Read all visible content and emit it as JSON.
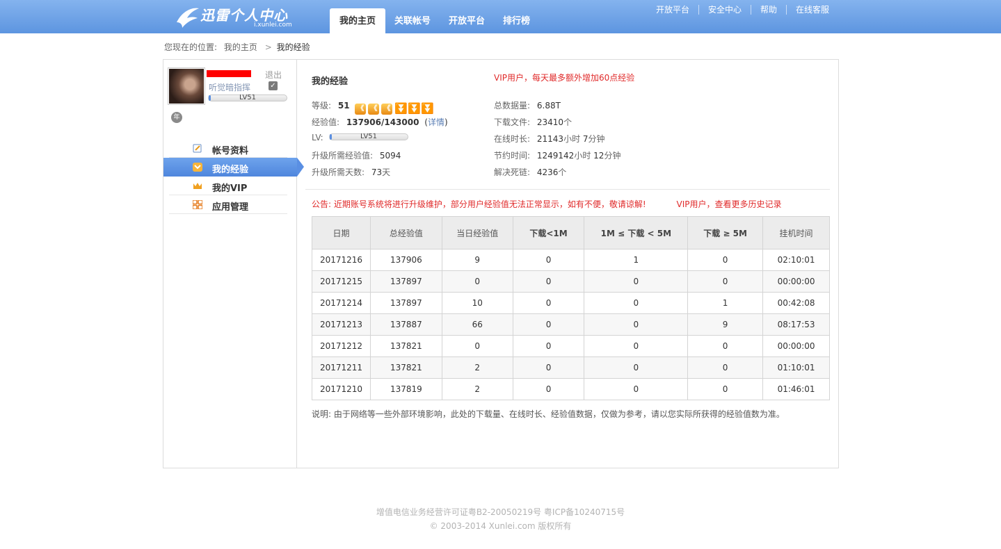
{
  "header": {
    "logo_title": "迅雷个人中心",
    "logo_url": "i.xunlei.com",
    "nav_tabs": [
      "我的主页",
      "关联帐号",
      "开放平台",
      "排行榜"
    ],
    "top_links": [
      "开放平台",
      "安全中心",
      "帮助",
      "在线客服"
    ],
    "brand_color": "#5d95e0"
  },
  "breadcrumb": {
    "prefix": "您现在的位置:",
    "link": "我的主页",
    "separator": ">",
    "current": "我的经验"
  },
  "sidebar": {
    "logout": "退出",
    "nickname": "听觉暗指挥",
    "edit_icon": "✓",
    "level_label": "LV51",
    "level_fill": 0.03,
    "year_badge": "年",
    "menu": [
      {
        "label": "帐号资料",
        "icon": "profile-icon"
      },
      {
        "label": "我的经验",
        "icon": "experience-icon"
      },
      {
        "label": "我的VIP",
        "icon": "crown-icon"
      },
      {
        "label": "应用管理",
        "icon": "apps-icon"
      }
    ]
  },
  "content": {
    "title": "我的经验",
    "vip_notice": "VIP用户，每天最多额外增加60点经验",
    "level": {
      "label": "等级:",
      "value": "51"
    },
    "exp": {
      "label": "经验值:",
      "value": "137906/143000",
      "open": "(",
      "link": "详情",
      "close": ")"
    },
    "lv": {
      "label": "LV:",
      "bar_label": "LV51",
      "fill": 0.03
    },
    "upgrade_exp": {
      "label": "升级所需经验值:",
      "value": "5094"
    },
    "upgrade_days": {
      "label": "升级所需天数:",
      "value": "73",
      "unit": "天"
    },
    "total_download": {
      "label": "总数据量:",
      "value": "6.88T"
    },
    "download_files": {
      "label": "下载文件:",
      "value": "23410",
      "unit": "个"
    },
    "online_time": {
      "label": "在线时长:",
      "hours": "21143",
      "h_unit": "小时",
      "minutes": "7",
      "m_unit": "分钟"
    },
    "saved_time": {
      "label": "节约时间:",
      "hours": "1249142",
      "h_unit": "小时",
      "minutes": "12",
      "m_unit": "分钟"
    },
    "dead_links": {
      "label": "解决死链:",
      "value": "4236",
      "unit": "个"
    },
    "announcement": "公告: 近期账号系统将进行升级维护，部分用户经验值无法正常显示，如有不便，敬请谅解!",
    "announcement_vip": "VIP用户，查看更多历史记录",
    "table": {
      "headers": [
        "日期",
        "总经验值",
        "当日经验值",
        "下载<1M",
        "1M ≤ 下载 < 5M",
        "下载 ≥ 5M",
        "挂机时间"
      ],
      "rows": [
        [
          "20171216",
          "137906",
          "9",
          "0",
          "1",
          "0",
          "02:10:01"
        ],
        [
          "20171215",
          "137897",
          "0",
          "0",
          "0",
          "0",
          "00:00:00"
        ],
        [
          "20171214",
          "137897",
          "10",
          "0",
          "0",
          "1",
          "00:42:08"
        ],
        [
          "20171213",
          "137887",
          "66",
          "0",
          "0",
          "9",
          "08:17:53"
        ],
        [
          "20171212",
          "137821",
          "0",
          "0",
          "0",
          "0",
          "00:00:00"
        ],
        [
          "20171211",
          "137821",
          "2",
          "0",
          "0",
          "0",
          "01:10:01"
        ],
        [
          "20171210",
          "137819",
          "2",
          "0",
          "0",
          "0",
          "01:46:01"
        ]
      ]
    },
    "note": "说明: 由于网络等一些外部环境影响，此处的下载量、在线时长、经验值数据，仅做为参考，请以您实际所获得的经验值数为准。"
  },
  "footer": {
    "license": "增值电信业务经营许可证粤B2-20050219号 粤ICP备10240715号",
    "copyright": "© 2003-2014 Xunlei.com 版权所有"
  }
}
